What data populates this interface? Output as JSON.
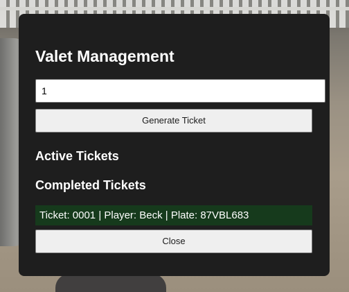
{
  "panel": {
    "title": "Valet Management",
    "ticket_input": {
      "value": "1",
      "placeholder": ""
    },
    "generate_button_label": "Generate Ticket",
    "active_heading": "Active Tickets",
    "active_tickets": [],
    "completed_heading": "Completed Tickets",
    "completed_tickets": [
      {
        "text": "Ticket: 0001 | Player: Beck | Plate: 87VBL683"
      }
    ],
    "close_button_label": "Close"
  },
  "colors": {
    "panel_background": "#1e1e1e",
    "completed_item_background": "#163a1c",
    "button_background": "#efefef",
    "text_primary": "#ffffff"
  }
}
